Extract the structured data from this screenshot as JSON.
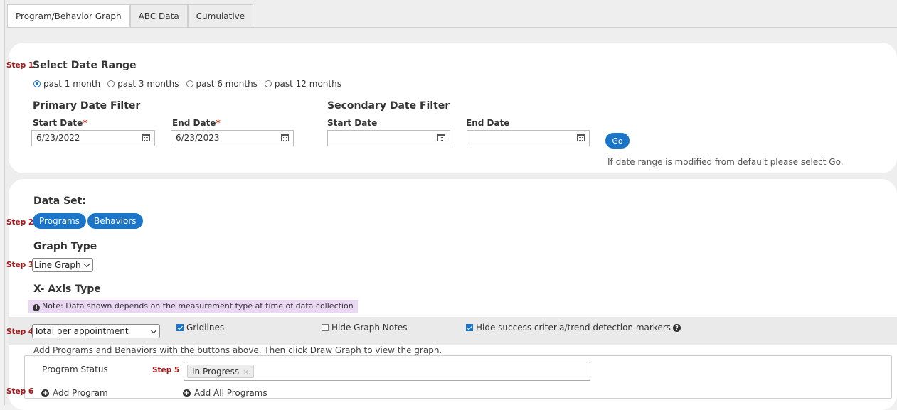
{
  "tabs": [
    {
      "label": "Program/Behavior Graph",
      "active": true
    },
    {
      "label": "ABC Data",
      "active": false
    },
    {
      "label": "Cumulative",
      "active": false
    }
  ],
  "steps": [
    "Step 1",
    "Step 2",
    "Step 3",
    "Step 4",
    "Step 5",
    "Step 6"
  ],
  "date_range": {
    "title": "Select Date Range",
    "options": [
      {
        "label": "past 1 month",
        "selected": true
      },
      {
        "label": "past 3 months",
        "selected": false
      },
      {
        "label": "past 6 months",
        "selected": false
      },
      {
        "label": "past 12 months",
        "selected": false
      }
    ],
    "primary": {
      "title": "Primary Date Filter",
      "start_label": "Start Date",
      "end_label": "End Date",
      "required_mark": "*",
      "start_value": "6/23/2022",
      "end_value": "6/23/2023"
    },
    "secondary": {
      "title": "Secondary Date Filter",
      "start_label": "Start Date",
      "end_label": "End Date",
      "start_value": "",
      "end_value": ""
    },
    "go_label": "Go",
    "hint": "If date range is modified from default please select Go."
  },
  "data_set": {
    "title": "Data Set:",
    "buttons": [
      "Programs",
      "Behaviors"
    ]
  },
  "graph_type": {
    "title": "Graph Type",
    "selected": "Line Graph"
  },
  "x_axis": {
    "title": "X- Axis Type",
    "note": "Note: Data shown depends on the measurement type at time of data collection",
    "selected": "Total per appointment"
  },
  "options": {
    "gridlines": {
      "label": "Gridlines",
      "checked": true
    },
    "hide_notes": {
      "label": "Hide Graph Notes",
      "checked": false
    },
    "hide_markers": {
      "label": "Hide success criteria/trend detection markers",
      "checked": true
    }
  },
  "instructions": "Add Programs and Behaviors with the buttons above. Then click Draw Graph to view the graph.",
  "program_status": {
    "label": "Program Status",
    "tag": "In Progress",
    "tag_remove": "×"
  },
  "add_program_label": "Add Program",
  "add_all_label": "Add All Programs",
  "colors": {
    "accent": "#1b75c9",
    "step": "#a3191b",
    "note_bg": "#ead7f3"
  }
}
